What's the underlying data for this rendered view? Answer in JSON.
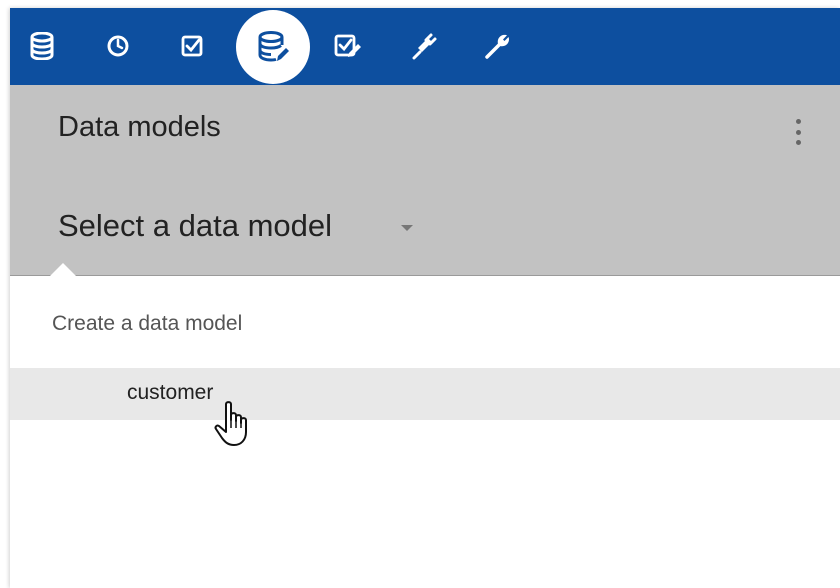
{
  "toolbar": {
    "icons": [
      {
        "name": "database-icon",
        "active": false
      },
      {
        "name": "clock-icon",
        "active": false
      },
      {
        "name": "checkbox-icon",
        "active": false
      },
      {
        "name": "database-edit-icon",
        "active": true
      },
      {
        "name": "checklist-edit-icon",
        "active": false
      },
      {
        "name": "plug-icon",
        "active": false
      },
      {
        "name": "wrench-icon",
        "active": false
      }
    ],
    "background": "#0d4f9f"
  },
  "header": {
    "title": "Data models",
    "select_label": "Select a data model",
    "background": "#c2c2c2"
  },
  "menu": {
    "create_label": "Create a data model",
    "items": [
      {
        "label": "customer",
        "hovered": true
      }
    ]
  }
}
